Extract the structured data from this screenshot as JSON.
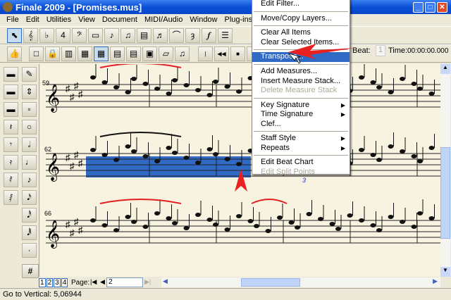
{
  "window": {
    "title": "Finale 2009 - [Promises.mus]"
  },
  "menubar": [
    "File",
    "Edit",
    "Utilities",
    "View",
    "Document",
    "MIDI/Audio",
    "Window",
    "Plug-ins",
    "T"
  ],
  "toolbar1": [
    "selection-tool",
    "staff-tool",
    "key-signature-tool",
    "time-signature-tool",
    "clef-tool",
    "measure-tool",
    "simple-entry-tool",
    "speedy-entry-tool",
    "hyperscribe-tool",
    "tuplet-tool",
    "smart-shape-tool",
    "articulation-tool",
    "expression-tool",
    "repeat-tool"
  ],
  "toolbar2": [
    "thumbs-up",
    "page-view",
    "lock",
    "layout",
    "grid",
    "selection-grid",
    "staff-grid",
    "red-grid",
    "document",
    "paper",
    "note-spacing"
  ],
  "playback": {
    "beat_label": "Beat:",
    "beat_value": "1",
    "time_label": "Time:",
    "time_value": "00:00:00.000"
  },
  "menu": {
    "items": [
      {
        "label": "Edit Filter...",
        "enabled": true
      },
      {
        "sep": true
      },
      {
        "label": "Move/Copy Layers...",
        "enabled": true
      },
      {
        "sep": true
      },
      {
        "label": "Clear All Items",
        "enabled": true
      },
      {
        "label": "Clear Selected Items...",
        "enabled": true
      },
      {
        "sep": true
      },
      {
        "label": "Transpose...",
        "enabled": true,
        "highlighted": true
      },
      {
        "sep": true
      },
      {
        "label": "Add Measures...",
        "enabled": true
      },
      {
        "label": "Insert Measure Stack...",
        "enabled": true
      },
      {
        "label": "Delete Measure Stack",
        "enabled": false
      },
      {
        "sep": true
      },
      {
        "label": "Key Signature",
        "enabled": true,
        "submenu": true
      },
      {
        "label": "Time Signature",
        "enabled": true,
        "submenu": true
      },
      {
        "label": "Clef...",
        "enabled": true
      },
      {
        "sep": true
      },
      {
        "label": "Staff Style",
        "enabled": true,
        "submenu": true
      },
      {
        "label": "Repeats",
        "enabled": true,
        "submenu": true
      },
      {
        "sep": true
      },
      {
        "label": "Edit Beat Chart",
        "enabled": true
      },
      {
        "label": "Edit Split Points",
        "enabled": false
      }
    ]
  },
  "score": {
    "measure_numbers": [
      "59",
      "62",
      "66"
    ],
    "tuplet_label": "3"
  },
  "bottom": {
    "layers": [
      "1",
      "2",
      "3",
      "4"
    ],
    "page_label": "Page:",
    "page_value": "2"
  },
  "status": {
    "text": "Go to Vertical: 5,06944"
  },
  "colors": {
    "selection": "#316ac5",
    "slur_red": "#e02020",
    "paper": "#f8f3e0"
  }
}
